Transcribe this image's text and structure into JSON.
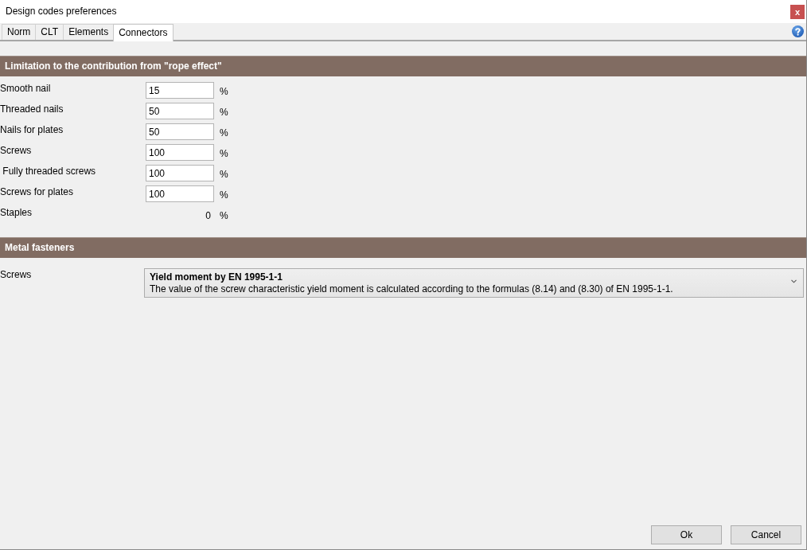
{
  "window": {
    "title": "Design codes preferences",
    "close_label": "x"
  },
  "tabs": [
    {
      "label": "Norm",
      "selected": false
    },
    {
      "label": "CLT",
      "selected": false
    },
    {
      "label": "Elements",
      "selected": false
    },
    {
      "label": "Connectors",
      "selected": true
    }
  ],
  "sections": [
    {
      "title": "Limitation to the contribution from \"rope effect\"",
      "rows": [
        {
          "kind": "input",
          "label": "Smooth nail",
          "value": "15",
          "unit": "%"
        },
        {
          "kind": "input",
          "label": "Threaded nails",
          "value": "50",
          "unit": "%"
        },
        {
          "kind": "input",
          "label": "Nails for plates",
          "value": "50",
          "unit": "%"
        },
        {
          "kind": "input",
          "label": "Screws",
          "value": "100",
          "unit": "%"
        },
        {
          "kind": "input",
          "label": " Fully threaded screws",
          "value": "100",
          "unit": "%"
        },
        {
          "kind": "input",
          "label": "Screws for plates",
          "value": "100",
          "unit": "%"
        },
        {
          "kind": "readonly",
          "label": "Staples",
          "value": "0",
          "unit": "%"
        }
      ]
    },
    {
      "title": "Metal fasteners",
      "rows": [
        {
          "kind": "dropdown",
          "label": "Screws",
          "option_title": "Yield moment by EN 1995-1-1",
          "option_description": "The value of the screw characteristic yield moment is calculated according to the formulas (8.14) and (8.30) of EN 1995-1-1."
        }
      ]
    }
  ],
  "buttons": [
    {
      "label": "Ok"
    },
    {
      "label": "Cancel"
    }
  ]
}
